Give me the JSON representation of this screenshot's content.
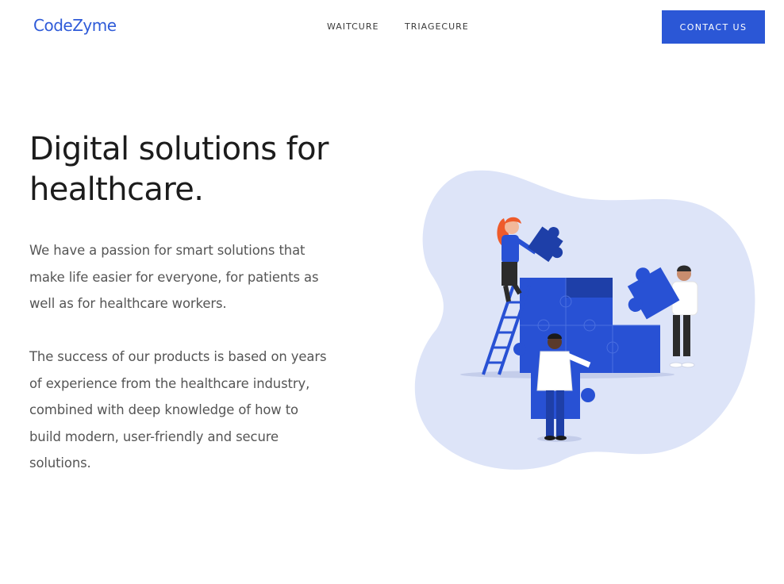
{
  "brand": {
    "name": "CodeZyme",
    "color": "#2f5bd8"
  },
  "nav": {
    "items": [
      {
        "label": "WAITCURE"
      },
      {
        "label": "TRIAGECURE"
      }
    ],
    "cta_label": "CONTACT US",
    "cta_color": "#2b57d6"
  },
  "hero": {
    "headline": "Digital solutions for healthcare.",
    "paragraphs": [
      "We have a passion for smart solutions that make life easier for everyone, for patients as well as for healthcare workers.",
      "The success of our products is based on years of experience from the healthcare industry, combined with deep knowledge of how to build modern, user-friendly and secure solutions."
    ]
  },
  "illustration": {
    "name": "people-assembling-puzzle-illustration",
    "colors": {
      "blob": "#dde4f8",
      "puzzle": "#2851d4",
      "puzzle_dark": "#1e3fa8",
      "hair": "#ee5b2b"
    }
  }
}
